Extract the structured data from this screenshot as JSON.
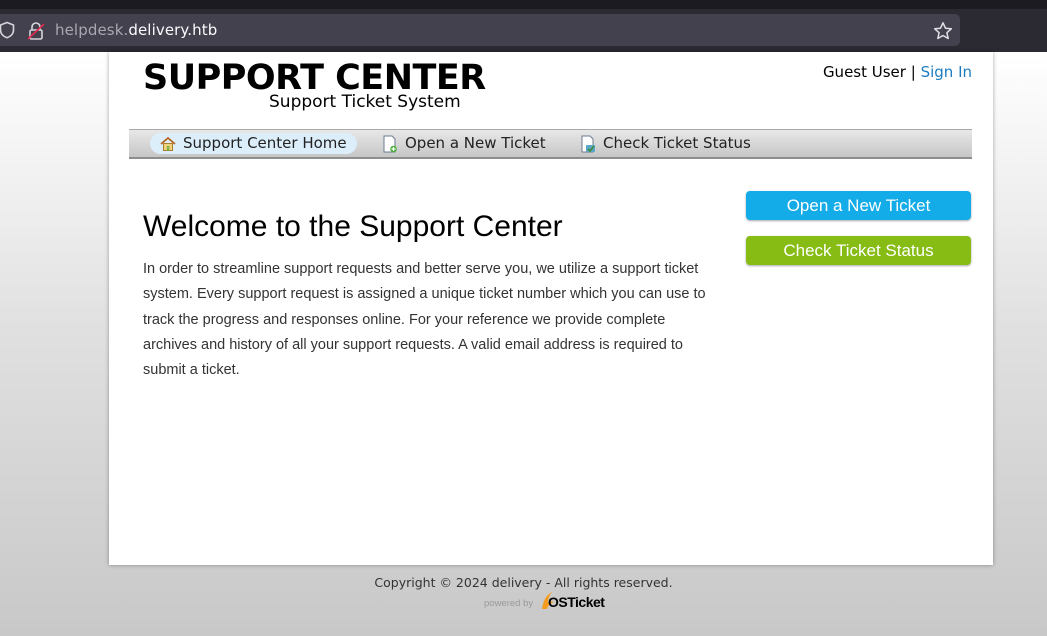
{
  "browser": {
    "url_subdomain": "helpdesk.",
    "url_domain": "delivery.htb"
  },
  "header": {
    "logo_title": "SUPPORT CENTER",
    "logo_subtitle": "Support Ticket System",
    "guest_label": "Guest User",
    "separator": "|",
    "sign_in": "Sign In"
  },
  "nav": {
    "items": [
      {
        "label": "Support Center Home",
        "icon": "home-icon"
      },
      {
        "label": "Open a New Ticket",
        "icon": "new-ticket-icon"
      },
      {
        "label": "Check Ticket Status",
        "icon": "ticket-status-icon"
      }
    ]
  },
  "main": {
    "title": "Welcome to the Support Center",
    "body": "In order to streamline support requests and better serve you, we utilize a support ticket system. Every support request is assigned a unique ticket number which you can use to track the progress and responses online. For your reference we provide complete archives and history of all your support requests. A valid email address is required to submit a ticket."
  },
  "sidebar": {
    "open_ticket_button": "Open a New Ticket",
    "check_status_button": "Check Ticket Status"
  },
  "footer": {
    "copyright": "Copyright © 2024 delivery - All rights reserved.",
    "powered_by": "powered by",
    "brand_os": "OS",
    "brand_ticket": "Ticket"
  },
  "colors": {
    "link": "#1b7dbf",
    "open_button": "#13abe8",
    "check_button": "#86bc14"
  }
}
